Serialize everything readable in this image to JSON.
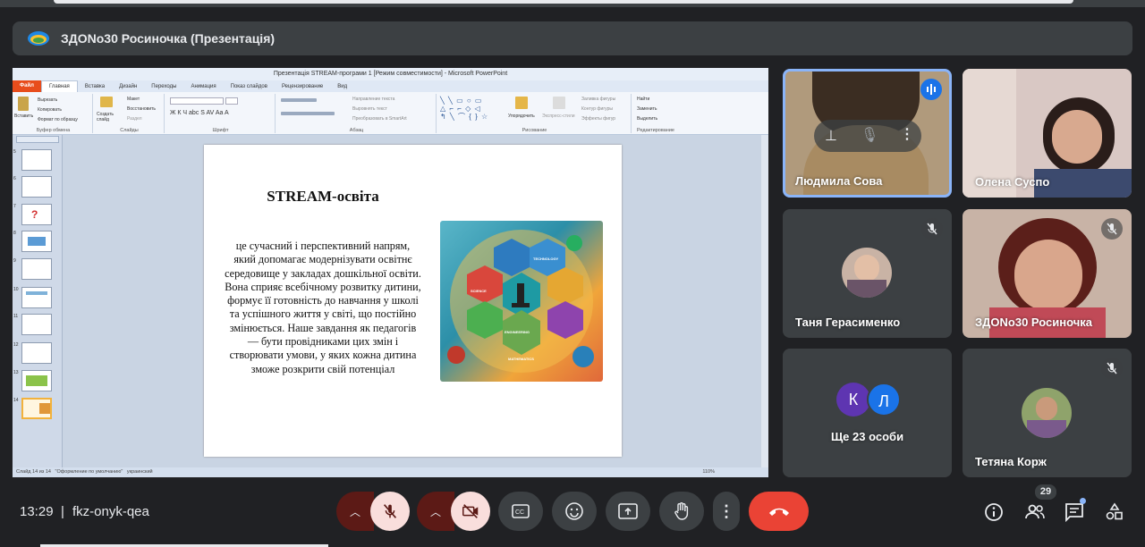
{
  "banner": {
    "title": "ЗДОNo30 Росиночка (Презентація)"
  },
  "powerpoint": {
    "window_title": "Презентація STREAM-програми 1 [Режим совместимости] - Microsoft PowerPoint",
    "tabs": [
      "Файл",
      "Главная",
      "Вставка",
      "Дизайн",
      "Переходы",
      "Анимация",
      "Показ слайдов",
      "Рецензирование",
      "Вид"
    ],
    "ribbon_groups": [
      "Буфер обмена",
      "Слайды",
      "Шрифт",
      "Абзац",
      "Рисование",
      "Редактирование"
    ],
    "ribbon_buttons": {
      "paste": "Вставить",
      "cut": "Вырезать",
      "copy": "Копировать",
      "format_painter": "Формат по образцу",
      "new_slide": "Создать слайд",
      "layout": "Макет",
      "reset": "Восстановить",
      "section": "Раздел",
      "text_direction": "Направление текста",
      "align_text": "Выровнять текст",
      "smartart": "Преобразовать в SmartArt",
      "arrange": "Упорядочить",
      "quick_styles": "Экспресс-стили",
      "shape_fill": "Заливка фигуры",
      "shape_outline": "Контур фигуры",
      "shape_effects": "Эффекты фигур",
      "find": "Найти",
      "replace": "Заменить",
      "select": "Выделить"
    },
    "status": {
      "slide": "Слайд 14 из 14",
      "theme": "\"Оформление по умолчанию\"",
      "lang": "украинский",
      "zoom": "110%"
    },
    "thumbnail_numbers": [
      "5",
      "6",
      "7",
      "8",
      "9",
      "10",
      "11",
      "12",
      "13",
      "14"
    ],
    "slide": {
      "title": "STREAM-освіта",
      "body": "це сучасний  і перспективний напрям, який допомагає  модернізувати  освітнє середовище у закладах  дошкільної освіти. Вона сприяє всебічному розвитку дитини, формує  її готовність до навчання у школі та успішного життя у світі, що постійно змінюється. Наше завдання як педагогів — бути провідниками цих змін і створювати умови, у яких кожна дитина зможе розкрити свій потенціал",
      "image_labels": [
        "SCIENCE",
        "TECHNOLOGY",
        "ENGINEERING",
        "MATHEMATICS"
      ]
    }
  },
  "participants": [
    {
      "name": "Людмила Сова",
      "speaking": true
    },
    {
      "name": "Олена Суспо"
    },
    {
      "name": "Таня Герасименко",
      "muted": true
    },
    {
      "name": "ЗДОNo30 Росиночка",
      "muted": true
    },
    {
      "name": "Ще 23 особи",
      "avatars": [
        "К",
        "Л"
      ]
    },
    {
      "name": "Тетяна Корж",
      "muted": true
    }
  ],
  "bottom": {
    "time": "13:29",
    "separator": "|",
    "meeting_code": "fkz-onyk-qea",
    "participant_count": "29"
  },
  "colors": {
    "accent_blue": "#8ab4f8",
    "end_call_red": "#ea4335",
    "avatar_k": "#5e35b1",
    "avatar_l": "#1a73e8"
  }
}
